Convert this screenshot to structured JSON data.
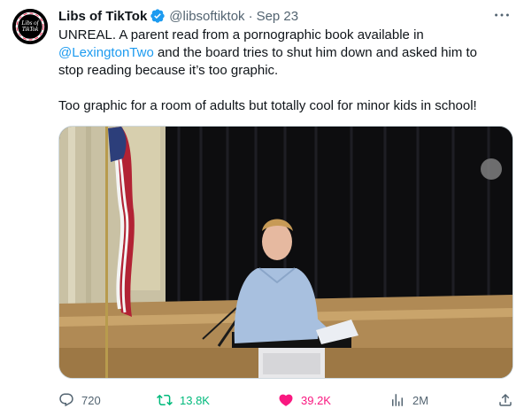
{
  "tweet": {
    "display_name": "Libs of TikTok",
    "handle": "@libsoftiktok",
    "separator": "·",
    "date": "Sep 23",
    "avatar_text_line1": "Libs of",
    "avatar_text_line2": "TikTok",
    "text_line1": "UNREAL. A parent read from a pornographic book available in",
    "mention": "@LexingtonTwo",
    "text_line2_rest": " and the board tries to shut him down and asked him to",
    "text_line3": "stop reading because it’s too graphic.",
    "text_paragraph2": "Too graphic for a room of adults but totally cool for minor kids in school!"
  },
  "actions": {
    "reply_count": "720",
    "retweet_count": "13.8K",
    "like_count": "39.2K",
    "views_count": "2M"
  },
  "colors": {
    "accent": "#1d9bf0",
    "retweet": "#00ba7c",
    "like": "#f91880",
    "secondary_text": "#536471"
  }
}
